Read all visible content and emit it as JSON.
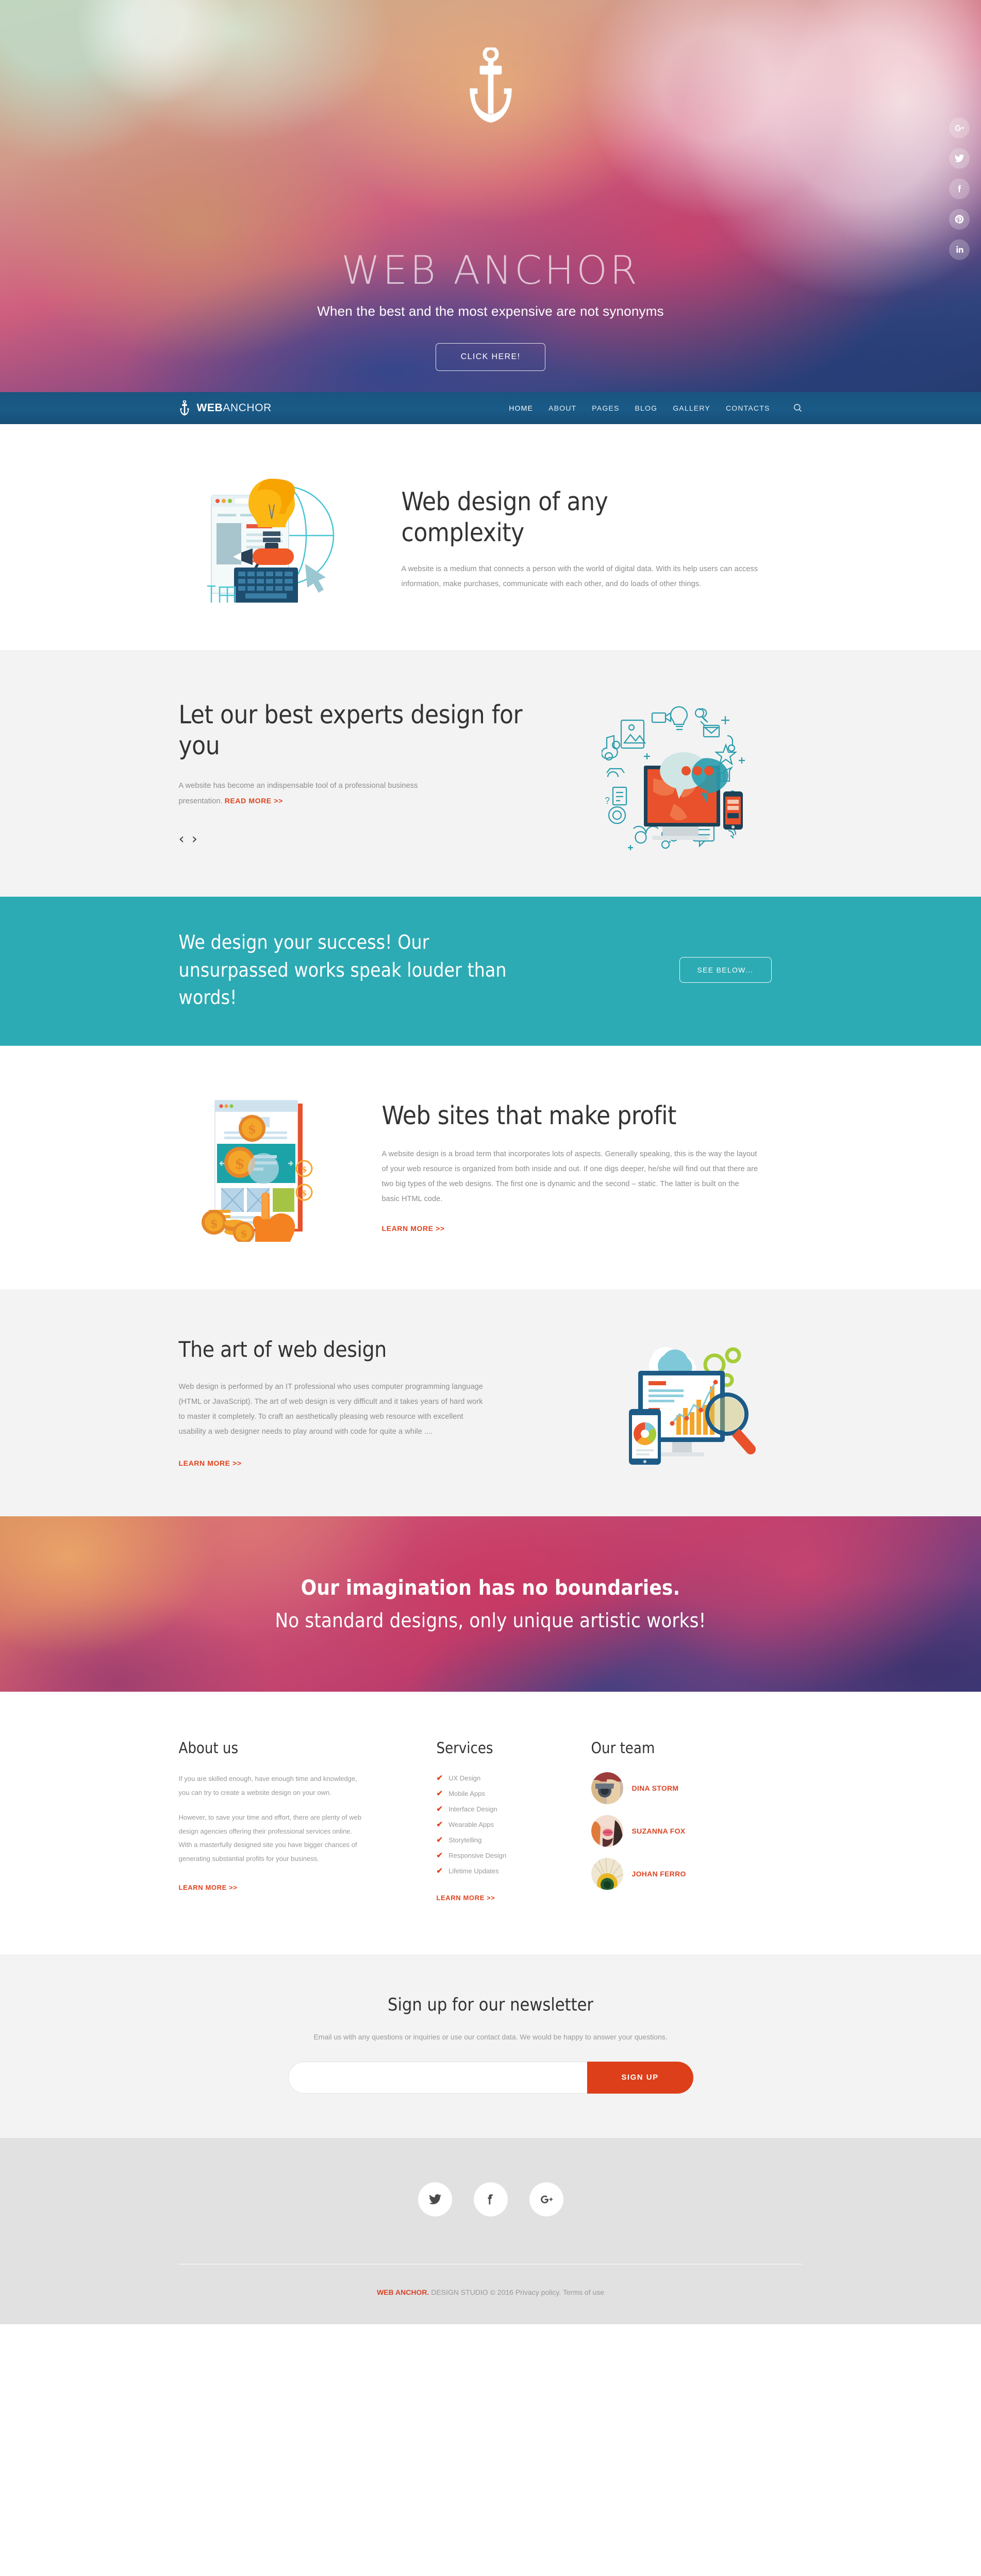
{
  "hero": {
    "logo_icon": "anchor-icon",
    "title_bold": "WEB",
    "title_light": " ANCHOR",
    "subtitle": "When the best and the most expensive are not synonyms",
    "cta": "CLICK HERE!",
    "social": [
      {
        "name": "google-plus-icon",
        "label": "G+"
      },
      {
        "name": "twitter-icon",
        "label": "Twitter"
      },
      {
        "name": "facebook-icon",
        "label": "f"
      },
      {
        "name": "pinterest-icon",
        "label": "Pinterest"
      },
      {
        "name": "linkedin-icon",
        "label": "in"
      }
    ]
  },
  "nav": {
    "brand_bold": "WEB",
    "brand_light": "ANCHOR",
    "links": [
      {
        "label": "HOME",
        "active": true
      },
      {
        "label": "ABOUT",
        "active": false
      },
      {
        "label": "PAGES",
        "active": false
      },
      {
        "label": "BLOG",
        "active": false
      },
      {
        "label": "GALLERY",
        "active": false
      },
      {
        "label": "CONTACTS",
        "active": false
      }
    ],
    "search_icon": "search-icon"
  },
  "section_complexity": {
    "title": "Web design of any complexity",
    "body": "A website is a medium that connects a person with the world of digital data. With its help users can access information, make purchases, communicate with each other, and do loads of other things."
  },
  "section_experts": {
    "title": "Let our best experts design for you",
    "body": "A website has become an indispensable tool of a professional business presentation. ",
    "more": "READ MORE >>",
    "prev": "‹",
    "next": "›"
  },
  "banner_success": {
    "text": "We design your success! Our unsurpassed works speak louder than words!",
    "button": "SEE BELOW...",
    "bg_color": "#2dabb4"
  },
  "section_profit": {
    "title": "Web sites that make profit",
    "body": "A website design is a broad term that incorporates lots of aspects. Generally speaking, this is the way the layout of your web resource is organized from both inside and out. If one digs deeper, he/she will find out that there are two big types of the web designs. The first one is dynamic and the second – static. The latter is built on the basic HTML code.",
    "more": "LEARN MORE >>"
  },
  "section_art": {
    "title": "The art of web design",
    "body": "Web design is performed by an IT professional who uses computer programming language (HTML or JavaScript). The art of web design is very difficult and it takes years of hard work to master it completely. To craft an aesthetically pleasing web resource with excellent usability a web designer needs to play around with code for quite a while ....",
    "more": "LEARN MORE >>"
  },
  "banner_imagination": {
    "line1": "Our imagination has no boundaries.",
    "line2": "No standard designs, only unique artistic works!"
  },
  "about": {
    "heading": "About us",
    "paragraphs": [
      "If you are skilled enough, have enough time and knowledge, you can try to create a website design on your own.",
      "However, to save your time and effort, there are plenty of web design agencies offering their professional services online. With a masterfully designed site you have bigger chances of generating substantial profits for your business."
    ],
    "more": "LEARN MORE >>"
  },
  "services": {
    "heading": "Services",
    "items": [
      "UX Design",
      "Mobile Apps",
      "Interface Design",
      "Wearable Apps",
      "Storytelling",
      "Responsive Design",
      "Lifetime Updates"
    ],
    "more": "LEARN MORE >>"
  },
  "team": {
    "heading": "Our team",
    "members": [
      {
        "name": "DINA STORM"
      },
      {
        "name": "SUZANNA FOX"
      },
      {
        "name": "JOHAN FERRO"
      }
    ]
  },
  "newsletter": {
    "heading": "Sign up for our newsletter",
    "subtext": "Email us with any questions or inquiries or use our contact data. We would be happy to answer your questions.",
    "input_value": "",
    "input_placeholder": "",
    "button": "SIGN UP"
  },
  "footer": {
    "social": [
      {
        "name": "twitter-icon"
      },
      {
        "name": "facebook-icon"
      },
      {
        "name": "google-plus-icon"
      }
    ],
    "copyright_brand": "WEB ANCHOR.",
    "copyright_rest": " DESIGN STUDIO © 2016 Privacy policy. Terms of use"
  },
  "colors": {
    "accent_orange": "#e0431d",
    "teal": "#2dabb4",
    "nav_blue": "#1a5a87"
  }
}
